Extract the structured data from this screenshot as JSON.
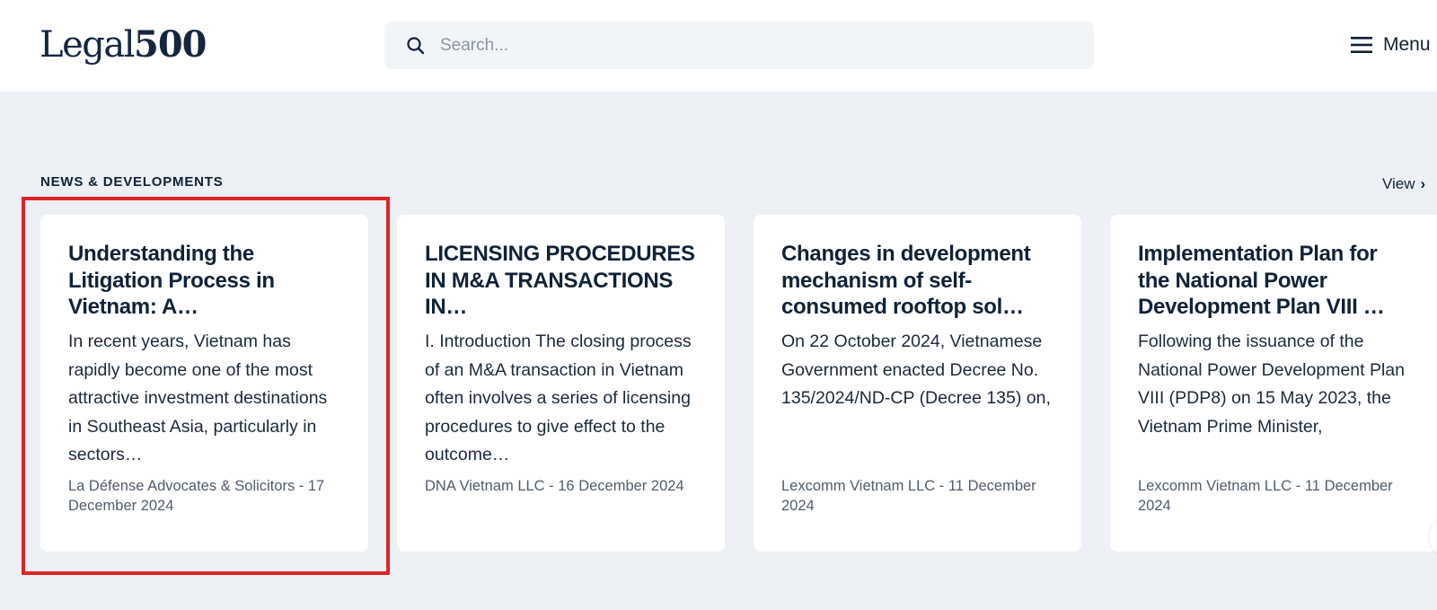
{
  "header": {
    "logo": {
      "text": "Legal",
      "number": "500"
    },
    "search": {
      "placeholder": "Search...",
      "value": "",
      "icon": "search-icon"
    },
    "menu": {
      "label": "Menu",
      "icon": "hamburger-icon"
    }
  },
  "section": {
    "title": "NEWS & DEVELOPMENTS",
    "view_label": "View",
    "view_icon": "chevron-right-icon"
  },
  "cards": [
    {
      "title": "Understanding the Litigation Process in Vietnam: A…",
      "summary": "In recent years, Vietnam has rapidly become one of the most attractive investment destinations in Southeast Asia, particularly in sectors…",
      "meta": "La Défense Advocates & Solicitors - 17 December 2024"
    },
    {
      "title": "LICENSING PROCEDURES IN M&A TRANSACTIONS IN…",
      "summary": "I. Introduction The closing process of an M&A transaction in Vietnam often involves a series of licensing procedures to give effect to the outcome…",
      "meta": "DNA Vietnam LLC - 16 December 2024"
    },
    {
      "title": "Changes in development mechanism of self-consumed rooftop sol…",
      "summary": "On 22 October 2024, Vietnamese Government enacted Decree No. 135/2024/ND-CP (Decree 135) on,",
      "meta": "Lexcomm Vietnam LLC - 11 December 2024"
    },
    {
      "title": "Implementation Plan for the National Power Development Plan VIII …",
      "summary": "Following the issuance of the National Power Development Plan VIII (PDP8) on 15 May 2023, the Vietnam Prime Minister,",
      "meta": "Lexcomm Vietnam LLC - 11 December 2024"
    }
  ],
  "colors": {
    "background": "#edf0f4",
    "header": "#ffffff",
    "text": "#0f2238",
    "meta": "#4f5d6c",
    "highlight": "#e02424"
  }
}
